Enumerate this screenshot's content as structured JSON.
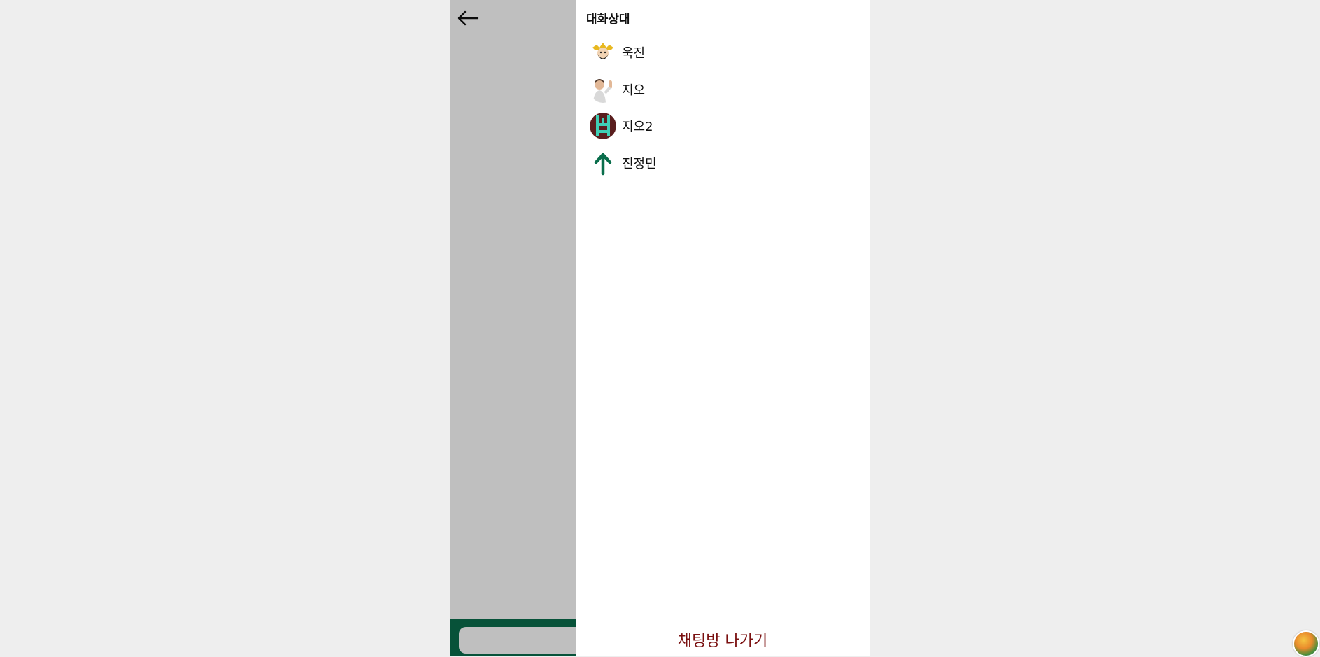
{
  "chat": {
    "back_icon": "arrow-left-icon",
    "input_value": ""
  },
  "drawer": {
    "title": "대화상대",
    "participants": [
      {
        "name": "욱진",
        "avatar": "avatar-character-gold-hair"
      },
      {
        "name": "지오",
        "avatar": "avatar-3d-boy-waving"
      },
      {
        "name": "지오2",
        "avatar": "avatar-teal-pattern"
      },
      {
        "name": "진정민",
        "avatar": "arrow-up-icon"
      }
    ],
    "leave_label": "채팅방 나가기"
  },
  "colors": {
    "brand": "#0a6e4c",
    "leave_text": "#7a1010",
    "overlay": "rgba(0,0,0,0.25)"
  },
  "corner_widget": {
    "icon": "landscape-badge-icon"
  }
}
